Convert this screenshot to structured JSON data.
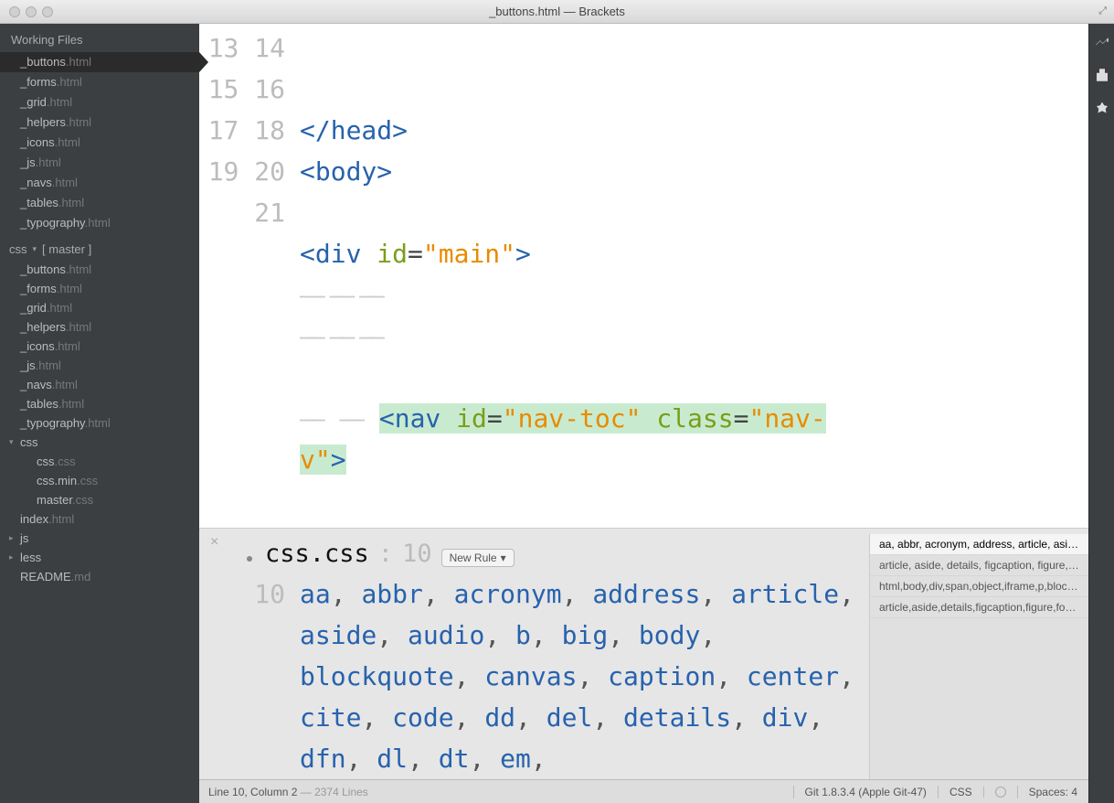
{
  "window": {
    "title": "_buttons.html — Brackets"
  },
  "sidebar": {
    "working_header": "Working Files",
    "working_files": [
      {
        "name": "_buttons",
        "ext": ".html",
        "active": true
      },
      {
        "name": "_forms",
        "ext": ".html"
      },
      {
        "name": "_grid",
        "ext": ".html"
      },
      {
        "name": "_helpers",
        "ext": ".html"
      },
      {
        "name": "_icons",
        "ext": ".html"
      },
      {
        "name": "_js",
        "ext": ".html"
      },
      {
        "name": "_navs",
        "ext": ".html"
      },
      {
        "name": "_tables",
        "ext": ".html"
      },
      {
        "name": "_typography",
        "ext": ".html"
      }
    ],
    "project_label": "css",
    "branch_label": "[ master ]",
    "tree": [
      {
        "type": "file",
        "name": "_buttons",
        "ext": ".html"
      },
      {
        "type": "file",
        "name": "_forms",
        "ext": ".html"
      },
      {
        "type": "file",
        "name": "_grid",
        "ext": ".html"
      },
      {
        "type": "file",
        "name": "_helpers",
        "ext": ".html"
      },
      {
        "type": "file",
        "name": "_icons",
        "ext": ".html"
      },
      {
        "type": "file",
        "name": "_js",
        "ext": ".html"
      },
      {
        "type": "file",
        "name": "_navs",
        "ext": ".html"
      },
      {
        "type": "file",
        "name": "_tables",
        "ext": ".html"
      },
      {
        "type": "file",
        "name": "_typography",
        "ext": ".html"
      },
      {
        "type": "folder",
        "name": "css",
        "open": true
      },
      {
        "type": "file",
        "sub": true,
        "name": "css",
        "ext": ".css"
      },
      {
        "type": "file",
        "sub": true,
        "name": "css.min",
        "ext": ".css"
      },
      {
        "type": "file",
        "sub": true,
        "name": "master",
        "ext": ".css"
      },
      {
        "type": "file",
        "name": "index",
        "ext": ".html"
      },
      {
        "type": "folder",
        "name": "js"
      },
      {
        "type": "folder",
        "name": "less"
      },
      {
        "type": "file",
        "name": "README",
        "ext": ".md"
      }
    ]
  },
  "editor": {
    "line_numbers": [
      "13",
      "14",
      "15",
      "16",
      "17",
      "18",
      "19",
      "20",
      "21"
    ],
    "l14": {
      "t1": "</head>"
    },
    "l15": {
      "t1": "<body>"
    },
    "l17": {
      "open": "<div ",
      "attr_id": "id",
      "eq": "=",
      "val_main": "\"main\"",
      "close": ">"
    },
    "l21": {
      "nav_open": "<nav ",
      "attr_id": "id",
      "eq": "=",
      "val_toc": "\"nav-toc\"",
      "sp": " ",
      "attr_class": "class",
      "val_navv1": "\"nav-",
      "val_navv2": "v\"",
      "close": ">"
    },
    "fold_marks": "—— —— ——"
  },
  "inline": {
    "filename": "css.css",
    "colon_line": " : ",
    "line": "10",
    "new_rule_label": "New Rule",
    "gutter": "10",
    "selectors": [
      "aa",
      "abbr",
      "acronym",
      "address",
      "article",
      "aside",
      "audio",
      "b",
      "big",
      "body",
      "blockquote",
      "canvas",
      "caption",
      "center",
      "cite",
      "code",
      "dd",
      "del",
      "details",
      "div",
      "dfn",
      "dl",
      "dt",
      "em"
    ],
    "rules": [
      "aa, abbr, acronym, address, article, aside, au…",
      "article, aside, details, figcaption, figure, foot…",
      "html,body,div,span,object,iframe,p,blockq…",
      "article,aside,details,figcaption,figure,footer…"
    ]
  },
  "status": {
    "cursor": "Line 10, Column 2",
    "total": " — 2374 Lines",
    "git": "Git 1.8.3.4 (Apple Git-47)",
    "lang": "CSS",
    "spaces": "Spaces:  4"
  }
}
